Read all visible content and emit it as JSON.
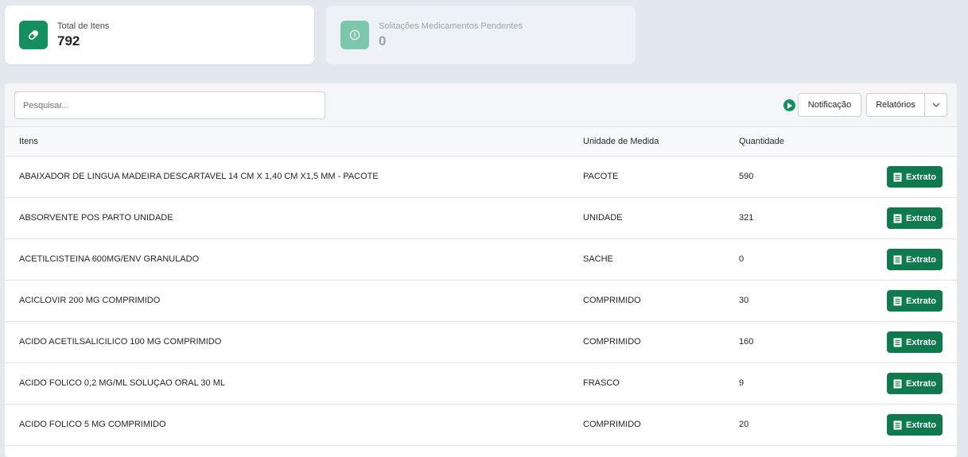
{
  "stats": {
    "total": {
      "label": "Total de Itens",
      "value": "792"
    },
    "pending": {
      "label": "Solitações Medicamentos Pendentes",
      "value": "0"
    }
  },
  "toolbar": {
    "search_placeholder": "Pesquisar...",
    "notification_label": "Notificação",
    "reports_label": "Relatórios"
  },
  "table": {
    "headers": {
      "item": "Itens",
      "unit": "Unidade de Medida",
      "qty": "Quantidade"
    },
    "action_label": "Extrato",
    "rows": [
      {
        "item": "ABAIXADOR DE LINGUA MADEIRA DESCARTAVEL 14 CM X 1,40 CM X1,5 MM - PACOTE",
        "unit": "PACOTE",
        "qty": "590"
      },
      {
        "item": "ABSORVENTE POS PARTO UNIDADE",
        "unit": "UNIDADE",
        "qty": "321"
      },
      {
        "item": "ACETILCISTEINA 600MG/ENV GRANULADO",
        "unit": "SACHE",
        "qty": "0"
      },
      {
        "item": "ACICLOVIR 200 MG COMPRIMIDO",
        "unit": "COMPRIMIDO",
        "qty": "30"
      },
      {
        "item": "ACIDO ACETILSALICILICO 100 MG COMPRIMIDO",
        "unit": "COMPRIMIDO",
        "qty": "160"
      },
      {
        "item": "ACIDO FOLICO 0,2 MG/ML SOLUÇAO ORAL 30 ML",
        "unit": "FRASCO",
        "qty": "9"
      },
      {
        "item": "ACIDO FOLICO 5 MG COMPRIMIDO",
        "unit": "COMPRIMIDO",
        "qty": "20"
      }
    ]
  },
  "colors": {
    "primary": "#168f5f",
    "button": "#0f7a4e",
    "muted_icon": "#7cc6ac"
  },
  "icons": {
    "total": "pill-icon",
    "pending": "alert-circle-icon",
    "row_action": "document-icon",
    "notification": "play-icon",
    "dropdown": "chevron-down-icon"
  }
}
